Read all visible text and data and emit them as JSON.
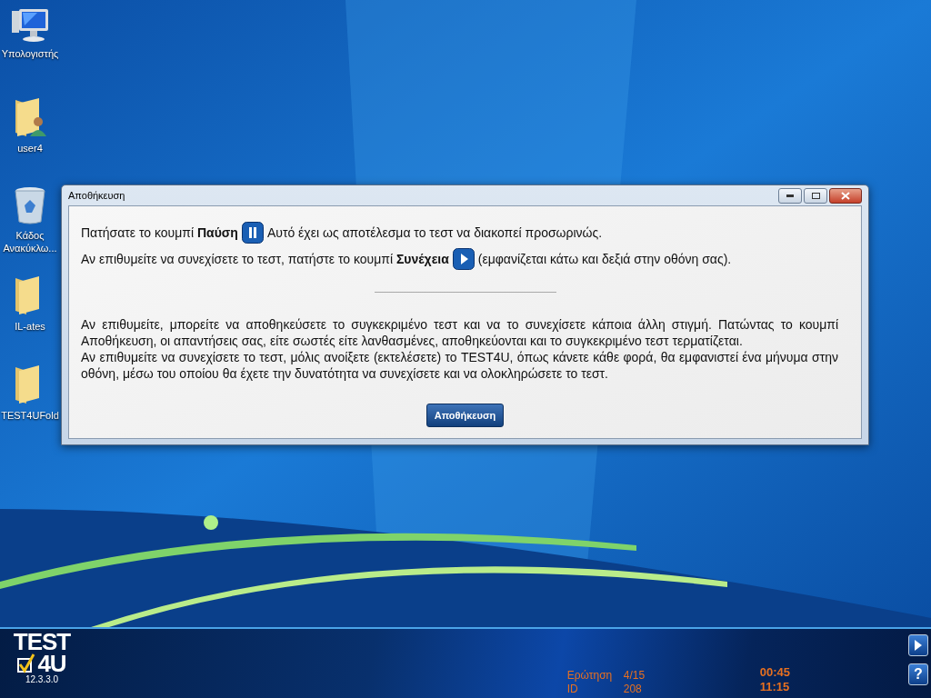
{
  "desktop_icons": [
    {
      "kind": "computer",
      "label": "Υπολογιστής"
    },
    {
      "kind": "user-folder",
      "label": "user4"
    },
    {
      "kind": "recycle-bin",
      "label": "Κάδος Ανακύκλω..."
    },
    {
      "kind": "folder",
      "label": "IL-ates"
    },
    {
      "kind": "folder",
      "label": "TEST4UFold"
    }
  ],
  "dialog": {
    "title": "Αποθήκευση",
    "line_1": {
      "before": "Πατήσατε το κουμπί **Παύση**",
      "kind": "pause",
      "after": "Αυτό έχει ως αποτέλεσμα το τεστ να διακοπεί προσωρινώς."
    },
    "line_2": {
      "before": "Αν επιθυμείτε να συνεχίσετε το τεστ, πατήστε το κουμπί **Συνέχεια**",
      "kind": "play",
      "after": "(εμφανίζεται κάτω και δεξιά στην οθόνη σας)."
    },
    "paragraphs": [
      "Αν επιθυμείτε, μπορείτε να αποθηκεύσετε το συγκεκριμένο τεστ και να το συνεχίσετε κάποια άλλη στιγμή. Πατώντας το κουμπί Αποθήκευση, οι απαντήσεις σας, είτε σωστές είτε λανθασμένες, αποθηκεύονται και το συγκεκριμένο τεστ τερματίζεται.",
      "Αν επιθυμείτε να συνεχίσετε το τεστ, μόλις ανοίξετε (εκτελέσετε) το TEST4U, όπως κάνετε κάθε φορά, θα εμφανιστεί ένα μήνυμα στην οθόνη, μέσω του οποίου θα έχετε την δυνατότητα να συνεχίσετε και να ολοκληρώσετε το τεστ."
    ],
    "button": "Αποθήκευση"
  },
  "bottom_bar": {
    "logo_top": "TEST",
    "logo_bottom": "4U",
    "version": "12.3.3.0",
    "question_label": "Ερώτηση",
    "question_value": "4/15",
    "id_label": "ID",
    "id_value": "208",
    "elapsed": "00:45",
    "clock": "11:15",
    "help": "?"
  }
}
